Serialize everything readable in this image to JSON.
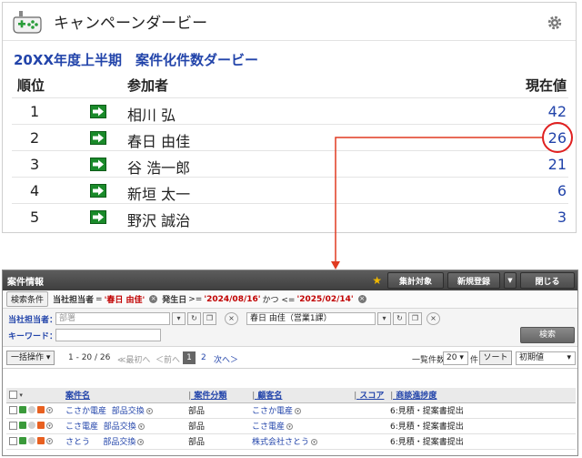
{
  "derby": {
    "title": "キャンペーンダービー",
    "subtitle": "20XX年度上半期　案件化件数ダービー",
    "columns": {
      "rank": "順位",
      "participant": "参加者",
      "current": "現在値"
    },
    "rows": [
      {
        "rank": "1",
        "name": "相川 弘",
        "value": "42"
      },
      {
        "rank": "2",
        "name": "春日 由佳",
        "value": "26"
      },
      {
        "rank": "3",
        "name": "谷 浩一郎",
        "value": "21"
      },
      {
        "rank": "4",
        "name": "新垣 太一",
        "value": "6"
      },
      {
        "rank": "5",
        "name": "野沢 誠治",
        "value": "3"
      }
    ],
    "link_color": "#2244aa",
    "highlight_color": "#e02020"
  },
  "cases": {
    "title": "案件情報",
    "header_buttons": {
      "aggregate": "集計対象",
      "new": "新規登録",
      "close": "閉じる"
    },
    "filter": {
      "button": "検索条件",
      "cond1_label": "当社担当者",
      "cond1_op": " = ",
      "cond1_value": "'春日 由佳'",
      "cond2_label": "発生日",
      "cond2_op1": " >= ",
      "cond2_value1": "'2024/08/16'",
      "cond2_mid": " かつ <= ",
      "cond2_value2": "'2025/02/14'"
    },
    "search": {
      "owner_label": "当社担当者：",
      "dept_placeholder": "部署",
      "owner_value": "春日 由佳（営業1課）",
      "keyword_label": "キーワード：",
      "keyword_value": "",
      "search_button": "検索"
    },
    "pager": {
      "bulk": "一括操作 ▾",
      "range": "1 - 20 / 26",
      "first": "≪最初へ",
      "prev": "＜前へ",
      "current_page": "1",
      "page2": "2",
      "next": "次へ＞",
      "per_page_label": "一覧件数",
      "per_page_value": "20",
      "per_page_unit": "件",
      "sort_button": "ソート",
      "sort_value": "初期値"
    },
    "table": {
      "headers": {
        "name": "案件名",
        "category": "案件分類",
        "customer": "顧客名",
        "score": "スコア",
        "progress": "商談進捗度"
      },
      "rows": [
        {
          "name_a": "こさか電産",
          "name_b": "部品交換",
          "category": "部品",
          "customer": "こさか電産",
          "score": "",
          "progress": "6:見積・提案書提出"
        },
        {
          "name_a": "こさ電産",
          "name_b": "部品交換",
          "category": "部品",
          "customer": "こさ電産",
          "score": "",
          "progress": "6:見積・提案書提出"
        },
        {
          "name_a": "さとう",
          "name_b": "部品交換",
          "category": "部品",
          "customer": "株式会社さとう",
          "score": "",
          "progress": "6:見積・提案書提出"
        }
      ]
    }
  }
}
